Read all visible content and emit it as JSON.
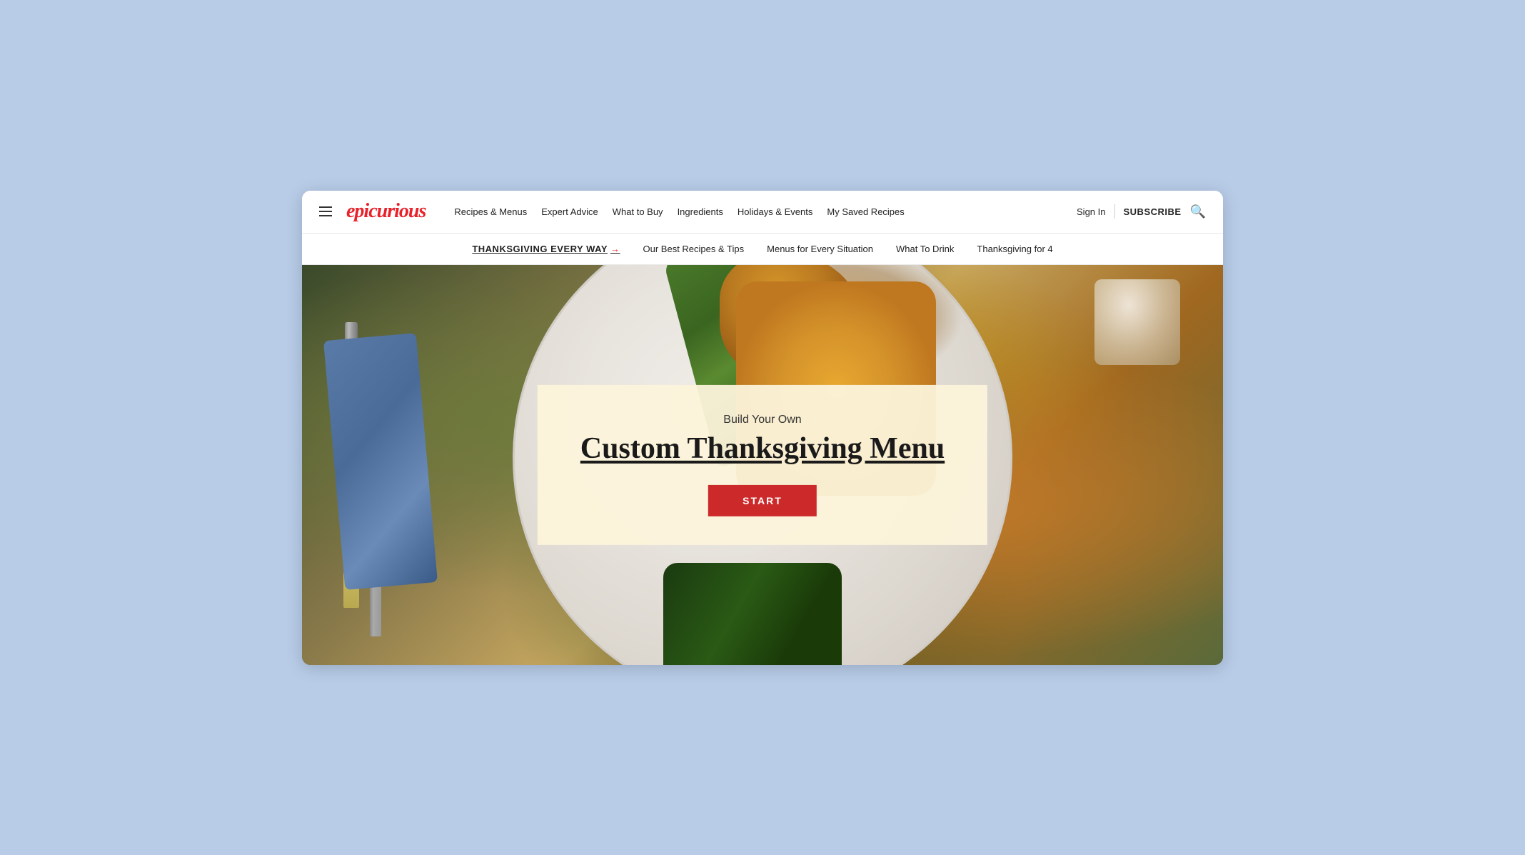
{
  "browser": {
    "background": "#b8cce8"
  },
  "header": {
    "logo": "epicurious",
    "nav_items": [
      {
        "label": "Recipes & Menus",
        "key": "recipes-menus"
      },
      {
        "label": "Expert Advice",
        "key": "expert-advice"
      },
      {
        "label": "What to Buy",
        "key": "what-to-buy"
      },
      {
        "label": "Ingredients",
        "key": "ingredients"
      },
      {
        "label": "Holidays & Events",
        "key": "holidays-events"
      },
      {
        "label": "My Saved Recipes",
        "key": "my-saved-recipes"
      }
    ],
    "sign_in": "Sign In",
    "subscribe": "SUBSCRIBE"
  },
  "subnav": {
    "highlight": "THANKSGIVING EVERY WAY",
    "arrow": "→",
    "links": [
      {
        "label": "Our Best Recipes & Tips"
      },
      {
        "label": "Menus for Every Situation"
      },
      {
        "label": "What To Drink"
      },
      {
        "label": "Thanksgiving for 4"
      }
    ]
  },
  "hero": {
    "overlay": {
      "subtitle": "Build Your Own",
      "title": "Custom Thanksgiving Menu",
      "button": "START"
    }
  }
}
